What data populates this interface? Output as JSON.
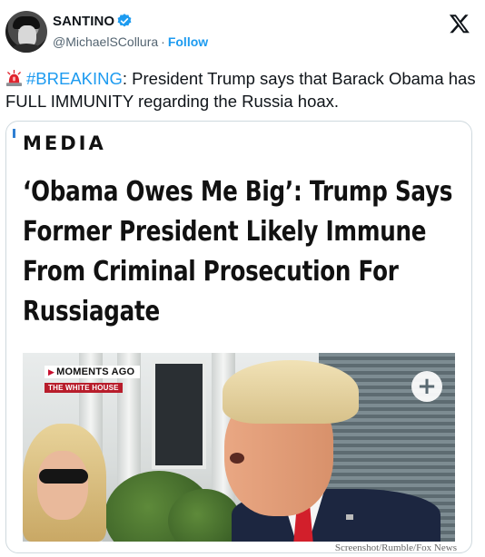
{
  "user": {
    "display_name": "SANTINO",
    "verified_icon": "verified-badge-icon",
    "handle": "@MichaelSCollura",
    "separator": "·",
    "follow_label": "Follow"
  },
  "platform_logo": "x-logo-icon",
  "tweet": {
    "emoji_icon": "police-siren-icon",
    "hashtag": "#BREAKING",
    "text": ": President Trump says that Barack Obama has FULL IMMUNITY regarding the Russia hoax."
  },
  "card": {
    "section": "MEDIA",
    "headline": "‘Obama Owes Me Big’: Trump Says Former President Likely Immune From Criminal Prosecution For Russiagate",
    "image": {
      "bug_top": "MOMENTS AGO",
      "bug_bottom": "THE WHITE HOUSE",
      "expand_icon": "plus-icon",
      "credit": "Screenshot/Rumble/Fox News"
    }
  },
  "colors": {
    "accent": "#1d9bf0",
    "text": "#0f1419",
    "muted": "#536471",
    "tv_red": "#b81d2b"
  }
}
